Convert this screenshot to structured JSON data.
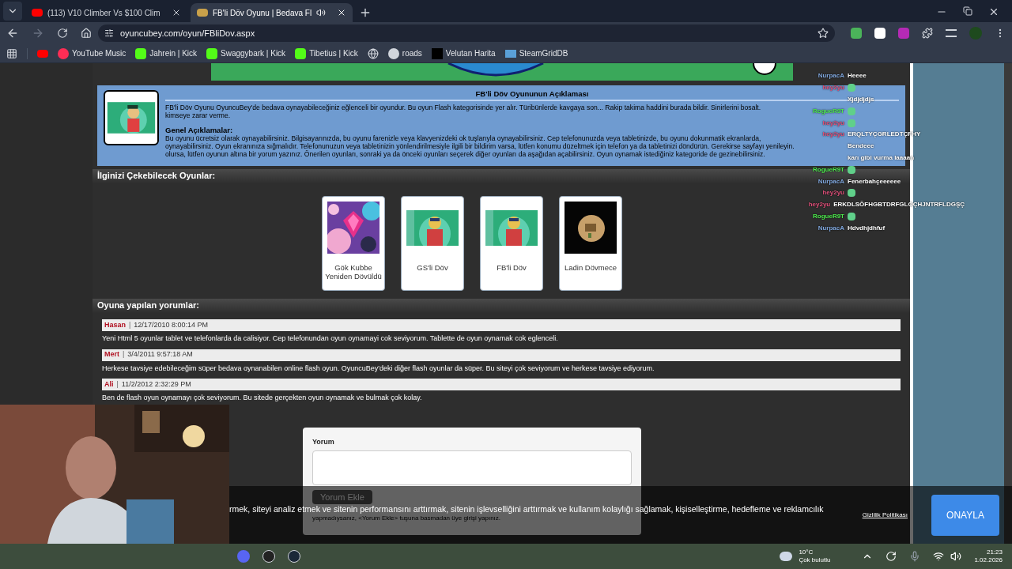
{
  "browser": {
    "tabs": [
      {
        "title": "(113) V10 Climber Vs $100 Clim",
        "selected": false
      },
      {
        "title": "FB'li Döv Oyunu | Bedava Fl",
        "selected": true
      }
    ],
    "url": "oyuncubey.com/oyun/FBliDov.aspx",
    "bookmarks": [
      {
        "label": "YouTube Music",
        "kind": "music"
      },
      {
        "label": "Jahrein | Kick",
        "kind": "kick"
      },
      {
        "label": "Swaggybark | Kick",
        "kind": "kick"
      },
      {
        "label": "Tibetius | Kick",
        "kind": "kick"
      },
      {
        "kind": "globe"
      },
      {
        "label": "roads",
        "kind": "circle"
      },
      {
        "label": "Velutan Harita",
        "kind": "wave"
      },
      {
        "label": "SteamGridDB",
        "kind": "steam"
      }
    ]
  },
  "description": {
    "title": "FB'li Döv Oyununun Açıklaması",
    "intro_lines": [
      "FB'li Döv Oyunu OyuncuBey'de bedava oynayabileceğiniz eğlenceli bir oyundur. Bu oyun Flash kategorisinde yer alır. Türibünlerde kavgaya son... Rakip takima haddini burada bildir. Sinirlerini bosalt.",
      "kimseye zarar verme."
    ],
    "heading": "Genel Açıklamalar:",
    "body_lines": [
      "Bu oyunu ücretsiz olarak oynayabilirsiniz. Bilgisayarınızda, bu oyunu farenizle veya klavyenizdeki ok tuşlarıyla oynayabilirsiniz. Cep telefonunuzda veya tabletinizde, bu oyunu dokunmatik ekranlarda,",
      "oynayabilirsiniz. Oyun ekranınıza sığmalıdır. Telefonunuzun veya tabletinizin yönlendirilmesiyle ilgili bir bildirim varsa, lütfen konumu düzeltmek için telefon ya da tabletinizi döndürün. Gerekirse sayfayı yenileyin.",
      "olursa, lütfen oyunun altına bir yorum yazınız. Önerilen oyunları, sonraki ya da önceki oyunları seçerek diğer oyunları da aşağıdan açabilirsiniz. Oyun oynamak istediğiniz kategoride de gezinebilirsiniz."
    ]
  },
  "related": {
    "title": "İlginizi Çekebilecek Oyunlar:",
    "games": [
      {
        "title": "Gök Kubbe Yeniden Dövüldü",
        "kind": "gem"
      },
      {
        "title": "GS'li Döv",
        "kind": "fan"
      },
      {
        "title": "FB'li Döv",
        "kind": "fan"
      },
      {
        "title": "Ladin Dövmece",
        "kind": "dark"
      }
    ]
  },
  "comments": {
    "title": "Oyuna yapılan yorumlar:",
    "items": [
      {
        "author": "Hasan",
        "separator": "|",
        "date": "12/17/2010 8:00:14 PM",
        "text": "Yeni Html 5 oyunlar tablet ve telefonlarda da calisiyor. Cep telefonundan oyun oynamayi cok seviyorum. Tablette de oyun oynamak cok eglenceli."
      },
      {
        "author": "Mert",
        "separator": "|",
        "date": "3/4/2011 9:57:18 AM",
        "text": "Herkese tavsiye edebileceğim süper bedava oynanabilen online flash oyun. OyuncuBey'deki diğer flash oyunlar da süper. Bu siteyi çok seviyorum ve herkese tavsiye ediyorum."
      },
      {
        "author": "Ali",
        "separator": "|",
        "date": "11/2/2012 2:32:29 PM",
        "text": "Ben de flash oyun oynamayı çok seviyorum. Bu sitede gerçekten oyun oynamak ve bulmak çok kolay."
      }
    ]
  },
  "comment_form": {
    "label": "Yorum",
    "button": "Yorum Ekle",
    "hint": "yapmadıysanız, <Yorum Ekle> tuşuna basmadan üye girişi yapınız."
  },
  "chat": [
    {
      "name": "NurpacA",
      "color": "#7fa6dc",
      "kind": "text",
      "message": "Heeee"
    },
    {
      "name": "hey2yu",
      "color": "#e0507a",
      "kind": "emote"
    },
    {
      "kind": "text",
      "message": "Xjdjdjdjs"
    },
    {
      "name": "RogueR9T",
      "color": "#4dea4d",
      "kind": "emote"
    },
    {
      "name": "hey2yu",
      "color": "#e0507a",
      "kind": "emote"
    },
    {
      "name": "hey2yu",
      "color": "#e0507a",
      "kind": "text",
      "message": "ERQLTYÇGRLEDTÇFHY"
    },
    {
      "kind": "text",
      "message": "Bendeee"
    },
    {
      "kind": "text",
      "message": "karı gibi vurma laaaan"
    },
    {
      "name": "RogueR9T",
      "color": "#4dea4d",
      "kind": "emote"
    },
    {
      "name": "NurpacA",
      "color": "#7fa6dc",
      "kind": "text",
      "message": "Fenerbahçeeeeee"
    },
    {
      "name": "hey2yu",
      "color": "#e0507a",
      "kind": "emote"
    },
    {
      "name": "hey2yu",
      "color": "#e0507a",
      "kind": "text",
      "message": "ERKDLSÖFHGBTDRFGLOÇHJNTRFLDGŞÇ"
    },
    {
      "name": "RogueR9T",
      "color": "#4dea4d",
      "kind": "emote"
    },
    {
      "name": "NurpacA",
      "color": "#7fa6dc",
      "kind": "text",
      "message": "Hdvdhjdhfuf"
    }
  ],
  "cookie_banner": {
    "text": "rmek, siteyi analiz etmek ve sitenin performansını arttırmak, sitenin işlevselliğini arttırmak ve kullanım kolaylığı sağlamak, kişiselleştirme, hedefleme ve reklamcılık",
    "link": "Gizlilik Politikası",
    "button": "ONAYLA"
  },
  "taskbar": {
    "temperature": "10°C",
    "weather": "Çok bulutlu",
    "time": "21:23",
    "date": "1.02.2026"
  }
}
